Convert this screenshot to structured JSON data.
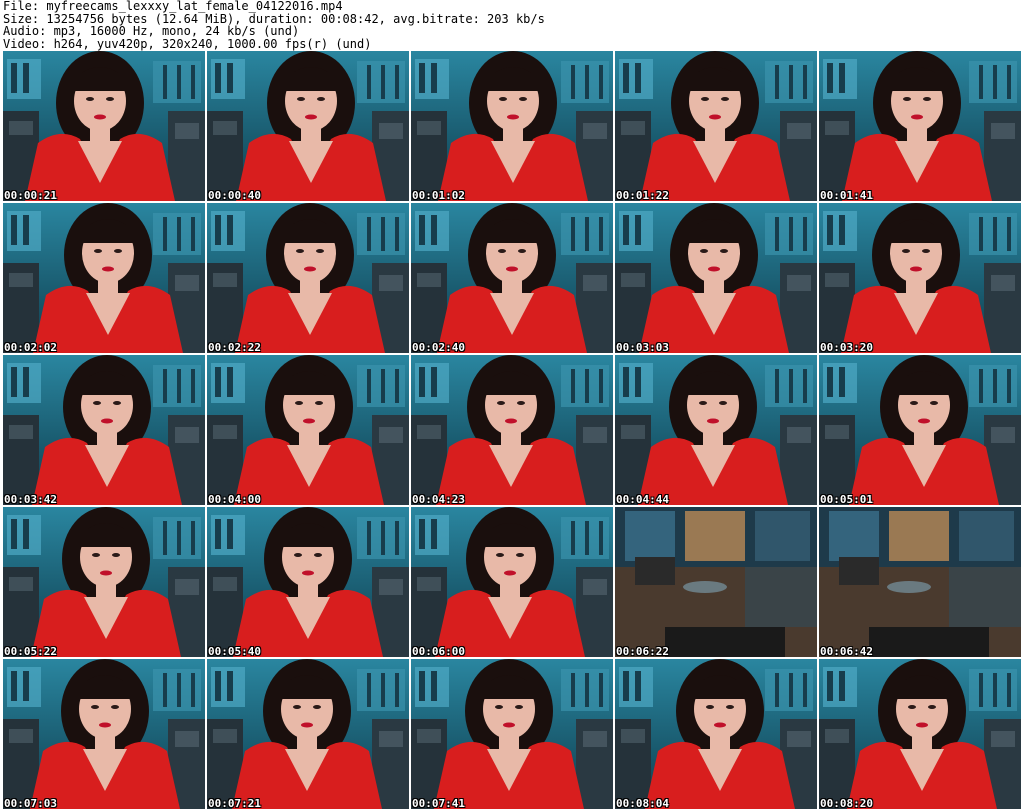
{
  "header": {
    "file": "File: myfreecams_lexxxy_lat_female_04122016.mp4",
    "size": "Size: 13254756 bytes (12.64 MiB), duration: 00:08:42, avg.bitrate: 203 kb/s",
    "audio": "Audio: mp3, 16000 Hz, mono, 24 kb/s (und)",
    "video": "Video: h264, yuv420p, 320x240, 1000.00 fps(r) (und)"
  },
  "thumbnails": [
    {
      "time": "00:00:21",
      "scene": "person"
    },
    {
      "time": "00:00:40",
      "scene": "person"
    },
    {
      "time": "00:01:02",
      "scene": "person"
    },
    {
      "time": "00:01:22",
      "scene": "person"
    },
    {
      "time": "00:01:41",
      "scene": "person"
    },
    {
      "time": "00:02:02",
      "scene": "person"
    },
    {
      "time": "00:02:22",
      "scene": "person"
    },
    {
      "time": "00:02:40",
      "scene": "person"
    },
    {
      "time": "00:03:03",
      "scene": "person"
    },
    {
      "time": "00:03:20",
      "scene": "person"
    },
    {
      "time": "00:03:42",
      "scene": "person"
    },
    {
      "time": "00:04:00",
      "scene": "person"
    },
    {
      "time": "00:04:23",
      "scene": "person"
    },
    {
      "time": "00:04:44",
      "scene": "person"
    },
    {
      "time": "00:05:01",
      "scene": "person"
    },
    {
      "time": "00:05:22",
      "scene": "person"
    },
    {
      "time": "00:05:40",
      "scene": "person"
    },
    {
      "time": "00:06:00",
      "scene": "person"
    },
    {
      "time": "00:06:22",
      "scene": "room"
    },
    {
      "time": "00:06:42",
      "scene": "room"
    },
    {
      "time": "00:07:03",
      "scene": "person"
    },
    {
      "time": "00:07:21",
      "scene": "person"
    },
    {
      "time": "00:07:41",
      "scene": "person"
    },
    {
      "time": "00:08:04",
      "scene": "person"
    },
    {
      "time": "00:08:20",
      "scene": "person"
    }
  ],
  "colors": {
    "background": "#ffffff",
    "wall": "#1f6f86",
    "shirt": "#d81e1e",
    "hair": "#1a0f0d",
    "skin": "#e8b9a8"
  }
}
